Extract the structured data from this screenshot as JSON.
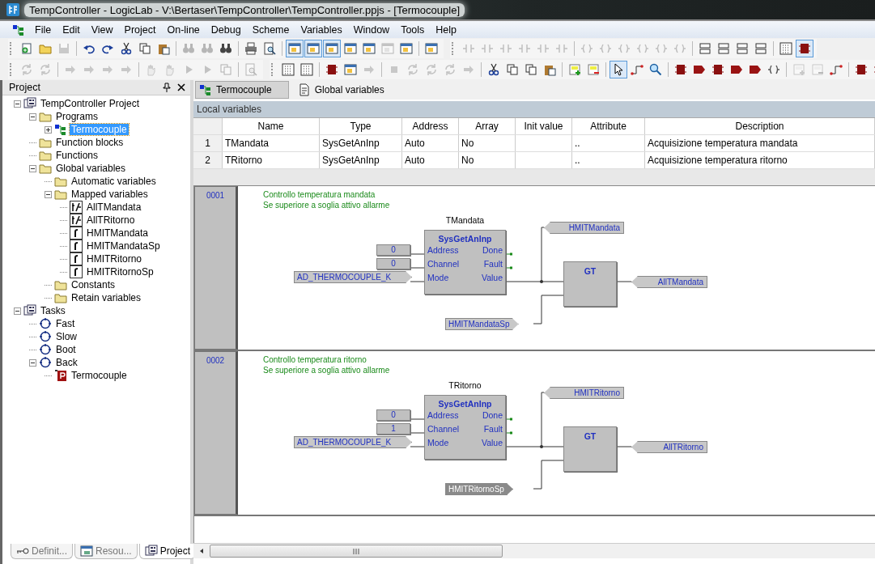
{
  "window": {
    "title": "TempController - LogicLab - V:\\Bertaser\\TempController\\TempController.ppjs - [Termocouple]"
  },
  "menu": [
    "File",
    "Edit",
    "View",
    "Project",
    "On-line",
    "Debug",
    "Scheme",
    "Variables",
    "Window",
    "Tools",
    "Help"
  ],
  "toolbar_rows": [
    [
      [
        [
          {
            "kind": "new",
            "disabled": false,
            "pressed": false
          },
          {
            "kind": "folder",
            "disabled": false,
            "pressed": false
          },
          {
            "kind": "disk",
            "disabled": true,
            "pressed": false
          }
        ],
        [
          {
            "kind": "undo",
            "disabled": false,
            "pressed": false
          },
          {
            "kind": "redo",
            "disabled": false,
            "pressed": false
          },
          {
            "kind": "scissors",
            "disabled": false,
            "pressed": false
          },
          {
            "kind": "copy",
            "disabled": false,
            "pressed": false
          },
          {
            "kind": "clipboard",
            "disabled": false,
            "pressed": false
          }
        ],
        [
          {
            "kind": "binoculars",
            "disabled": true,
            "pressed": false
          },
          {
            "kind": "binoculars",
            "disabled": true,
            "pressed": false
          },
          {
            "kind": "binoculars",
            "disabled": false,
            "pressed": false
          }
        ],
        [
          {
            "kind": "print",
            "disabled": false,
            "pressed": false
          },
          {
            "kind": "preview",
            "disabled": false,
            "pressed": false
          }
        ],
        [
          {
            "kind": "window",
            "disabled": false,
            "pressed": true
          },
          {
            "kind": "window",
            "disabled": false,
            "pressed": true
          },
          {
            "kind": "window",
            "disabled": false,
            "pressed": true
          },
          {
            "kind": "window",
            "disabled": false,
            "pressed": false
          },
          {
            "kind": "window",
            "disabled": false,
            "pressed": false
          },
          {
            "kind": "window",
            "disabled": true,
            "pressed": false
          },
          {
            "kind": "window",
            "disabled": false,
            "pressed": false
          }
        ],
        [
          {
            "kind": "window",
            "disabled": false,
            "pressed": false
          }
        ]
      ],
      [
        [
          {
            "kind": "contact",
            "disabled": true,
            "pressed": false
          },
          {
            "kind": "contact",
            "disabled": true,
            "pressed": false
          },
          {
            "kind": "contact",
            "disabled": true,
            "pressed": false
          },
          {
            "kind": "contact",
            "disabled": true,
            "pressed": false
          },
          {
            "kind": "contact",
            "disabled": true,
            "pressed": false
          },
          {
            "kind": "contact",
            "disabled": true,
            "pressed": false
          }
        ],
        [
          {
            "kind": "coil",
            "disabled": true,
            "pressed": false
          },
          {
            "kind": "coil",
            "disabled": true,
            "pressed": false
          },
          {
            "kind": "coil",
            "disabled": true,
            "pressed": false
          },
          {
            "kind": "coil",
            "disabled": true,
            "pressed": false
          },
          {
            "kind": "coil",
            "disabled": true,
            "pressed": false
          },
          {
            "kind": "coil",
            "disabled": true,
            "pressed": false
          }
        ],
        [
          {
            "kind": "rows",
            "disabled": false,
            "pressed": false
          },
          {
            "kind": "rows",
            "disabled": false,
            "pressed": false
          },
          {
            "kind": "rows",
            "disabled": false,
            "pressed": false
          },
          {
            "kind": "rows",
            "disabled": false,
            "pressed": false
          }
        ],
        [
          {
            "kind": "grid",
            "disabled": false,
            "pressed": false
          },
          {
            "kind": "block",
            "disabled": false,
            "pressed": true
          }
        ]
      ]
    ],
    [
      [
        [
          {
            "kind": "refresh",
            "disabled": true,
            "pressed": false
          },
          {
            "kind": "refresh",
            "disabled": true,
            "pressed": false
          }
        ],
        [
          {
            "kind": "arrow",
            "disabled": true,
            "pressed": false
          },
          {
            "kind": "arrow",
            "disabled": true,
            "pressed": false
          },
          {
            "kind": "arrow",
            "disabled": true,
            "pressed": false
          },
          {
            "kind": "arrow",
            "disabled": true,
            "pressed": false
          }
        ],
        [
          {
            "kind": "hand",
            "disabled": true,
            "pressed": false
          },
          {
            "kind": "hand",
            "disabled": true,
            "pressed": false
          },
          {
            "kind": "play",
            "disabled": true,
            "pressed": false
          },
          {
            "kind": "play",
            "disabled": true,
            "pressed": false
          },
          {
            "kind": "copy",
            "disabled": true,
            "pressed": false
          }
        ],
        [
          {
            "kind": "preview",
            "disabled": true,
            "pressed": false
          }
        ]
      ],
      [
        [
          {
            "kind": "grid",
            "disabled": false,
            "pressed": false
          },
          {
            "kind": "grid",
            "disabled": false,
            "pressed": false
          }
        ],
        [
          {
            "kind": "block",
            "disabled": false,
            "pressed": false
          },
          {
            "kind": "window",
            "disabled": false,
            "pressed": false
          },
          {
            "kind": "arrow",
            "disabled": true,
            "pressed": false
          }
        ],
        [
          {
            "kind": "stop",
            "disabled": true,
            "pressed": false
          },
          {
            "kind": "refresh",
            "disabled": true,
            "pressed": false
          },
          {
            "kind": "refresh",
            "disabled": true,
            "pressed": false
          },
          {
            "kind": "refresh",
            "disabled": true,
            "pressed": false
          },
          {
            "kind": "arrow",
            "disabled": true,
            "pressed": false
          }
        ],
        [
          {
            "kind": "scissors",
            "disabled": false,
            "pressed": false
          },
          {
            "kind": "copy",
            "disabled": false,
            "pressed": false
          },
          {
            "kind": "copy",
            "disabled": false,
            "pressed": false
          },
          {
            "kind": "clipboard",
            "disabled": false,
            "pressed": false
          }
        ],
        [
          {
            "kind": "plus",
            "disabled": false,
            "pressed": false
          },
          {
            "kind": "minus",
            "disabled": false,
            "pressed": false
          }
        ],
        [
          {
            "kind": "cursor",
            "disabled": false,
            "pressed": true
          },
          {
            "kind": "wire",
            "disabled": false,
            "pressed": false
          },
          {
            "kind": "magnifier",
            "disabled": false,
            "pressed": false
          }
        ],
        [
          {
            "kind": "block",
            "disabled": false,
            "pressed": false
          },
          {
            "kind": "tag",
            "disabled": false,
            "pressed": false
          },
          {
            "kind": "block",
            "disabled": false,
            "pressed": false
          },
          {
            "kind": "tag",
            "disabled": false,
            "pressed": false
          },
          {
            "kind": "tag",
            "disabled": false,
            "pressed": false
          },
          {
            "kind": "coil",
            "disabled": false,
            "pressed": false
          }
        ],
        [
          {
            "kind": "plus",
            "disabled": true,
            "pressed": false
          },
          {
            "kind": "minus",
            "disabled": true,
            "pressed": false
          },
          {
            "kind": "wire",
            "disabled": false,
            "pressed": false
          }
        ],
        [
          {
            "kind": "block",
            "disabled": false,
            "pressed": false
          },
          {
            "kind": "block",
            "disabled": false,
            "pressed": false
          }
        ]
      ]
    ]
  ],
  "project_panel": {
    "title": "Project",
    "tree": [
      {
        "label": "TempController Project",
        "kind": "project",
        "expanded": true,
        "selected": false,
        "children": [
          {
            "label": "Programs",
            "kind": "folder",
            "expanded": true,
            "selected": false,
            "children": [
              {
                "label": "Termocouple",
                "kind": "program",
                "expanded": false,
                "selected": true
              }
            ]
          },
          {
            "label": "Function blocks",
            "kind": "folder",
            "selected": false
          },
          {
            "label": "Functions",
            "kind": "folder",
            "selected": false
          },
          {
            "label": "Global variables",
            "kind": "folder",
            "expanded": true,
            "selected": false,
            "children": [
              {
                "label": "Automatic variables",
                "kind": "folder",
                "selected": false
              },
              {
                "label": "Mapped variables",
                "kind": "folder",
                "expanded": true,
                "selected": false,
                "children": [
                  {
                    "label": "AllTMandata",
                    "kind": "bool",
                    "selected": false
                  },
                  {
                    "label": "AllTRitorno",
                    "kind": "bool",
                    "selected": false
                  },
                  {
                    "label": "HMITMandata",
                    "kind": "real",
                    "selected": false
                  },
                  {
                    "label": "HMITMandataSp",
                    "kind": "real",
                    "selected": false
                  },
                  {
                    "label": "HMITRitorno",
                    "kind": "real",
                    "selected": false
                  },
                  {
                    "label": "HMITRitornoSp",
                    "kind": "real",
                    "selected": false
                  }
                ]
              },
              {
                "label": "Constants",
                "kind": "folder",
                "selected": false
              },
              {
                "label": "Retain variables",
                "kind": "folder",
                "selected": false
              }
            ]
          }
        ]
      },
      {
        "label": "Tasks",
        "kind": "project",
        "expanded": true,
        "selected": false,
        "children": [
          {
            "label": "Fast",
            "kind": "task",
            "selected": false
          },
          {
            "label": "Slow",
            "kind": "task",
            "selected": false
          },
          {
            "label": "Boot",
            "kind": "task",
            "selected": false
          },
          {
            "label": "Back",
            "kind": "task",
            "expanded": true,
            "selected": false,
            "children": [
              {
                "label": "Termocouple",
                "kind": "pou",
                "selected": false
              }
            ]
          }
        ]
      }
    ],
    "bottom_tabs": [
      {
        "label": "Definit...",
        "kind": "key",
        "selected": false
      },
      {
        "label": "Resou...",
        "kind": "window",
        "selected": false
      },
      {
        "label": "Project",
        "kind": "project",
        "selected": true
      }
    ]
  },
  "doc_tabs": [
    {
      "label": "Termocouple",
      "kind": "program",
      "selected": true
    },
    {
      "label": "Global variables",
      "kind": "page",
      "selected": false
    }
  ],
  "local_variables": {
    "title": "Local variables",
    "columns": [
      "Name",
      "Type",
      "Address",
      "Array",
      "Init value",
      "Attribute",
      "Description"
    ],
    "rows": [
      {
        "number": "1",
        "cells": [
          "TMandata",
          "SysGetAnInp",
          "Auto",
          "No",
          "",
          "..",
          "Acquisizione temperatura mandata"
        ]
      },
      {
        "number": "2",
        "cells": [
          "TRitorno",
          "SysGetAnInp",
          "Auto",
          "No",
          "",
          "..",
          "Acquisizione temperatura ritorno"
        ]
      }
    ]
  },
  "networks": [
    {
      "number": "0001",
      "comment": [
        "Controllo temperatura mandata",
        "Se superiore a soglia attivo allarme"
      ],
      "block": {
        "instance": "TMandata",
        "type": "SysGetAnInp",
        "inputs": [
          {
            "pin": "Address",
            "source": {
              "kind": "constant",
              "text": "0"
            }
          },
          {
            "pin": "Channel",
            "source": {
              "kind": "constant",
              "text": "0"
            }
          },
          {
            "pin": "Mode",
            "source": {
              "kind": "variable",
              "text": "AD_THERMOCOUPLE_K"
            }
          }
        ],
        "outputs": [
          "Done",
          "Fault",
          "Value"
        ]
      },
      "monitor": {
        "name": "HMITMandata",
        "selected": false
      },
      "compare": "GT",
      "result": {
        "name": "AllTMandata",
        "selected": false
      },
      "setpoint": {
        "name": "HMITMandataSp",
        "selected": false
      }
    },
    {
      "number": "0002",
      "comment": [
        "Controllo temperatura ritorno",
        "Se superiore a soglia attivo allarme"
      ],
      "block": {
        "instance": "TRitorno",
        "type": "SysGetAnInp",
        "inputs": [
          {
            "pin": "Address",
            "source": {
              "kind": "constant",
              "text": "0"
            }
          },
          {
            "pin": "Channel",
            "source": {
              "kind": "constant",
              "text": "1"
            }
          },
          {
            "pin": "Mode",
            "source": {
              "kind": "variable",
              "text": "AD_THERMOCOUPLE_K"
            }
          }
        ],
        "outputs": [
          "Done",
          "Fault",
          "Value"
        ]
      },
      "monitor": {
        "name": "HMITRitorno",
        "selected": false
      },
      "compare": "GT",
      "result": {
        "name": "AllTRitorno",
        "selected": false
      },
      "setpoint": {
        "name": "HMITRitornoSp",
        "selected": true
      }
    }
  ]
}
